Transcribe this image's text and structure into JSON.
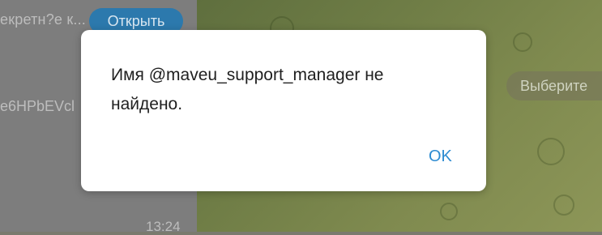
{
  "chat_list": {
    "preview_text": "екретн?е к...",
    "open_button_label": "Открыть",
    "preview_text_2": "e6HPbEVcl",
    "timestamp": "13:24"
  },
  "chat_area": {
    "select_chat_pill": "Выберите"
  },
  "dialog": {
    "message": "Имя @maveu_support_manager не найдено.",
    "ok_label": "OK"
  },
  "colors": {
    "accent": "#2d8bd1",
    "open_button": "#2c79ad"
  }
}
